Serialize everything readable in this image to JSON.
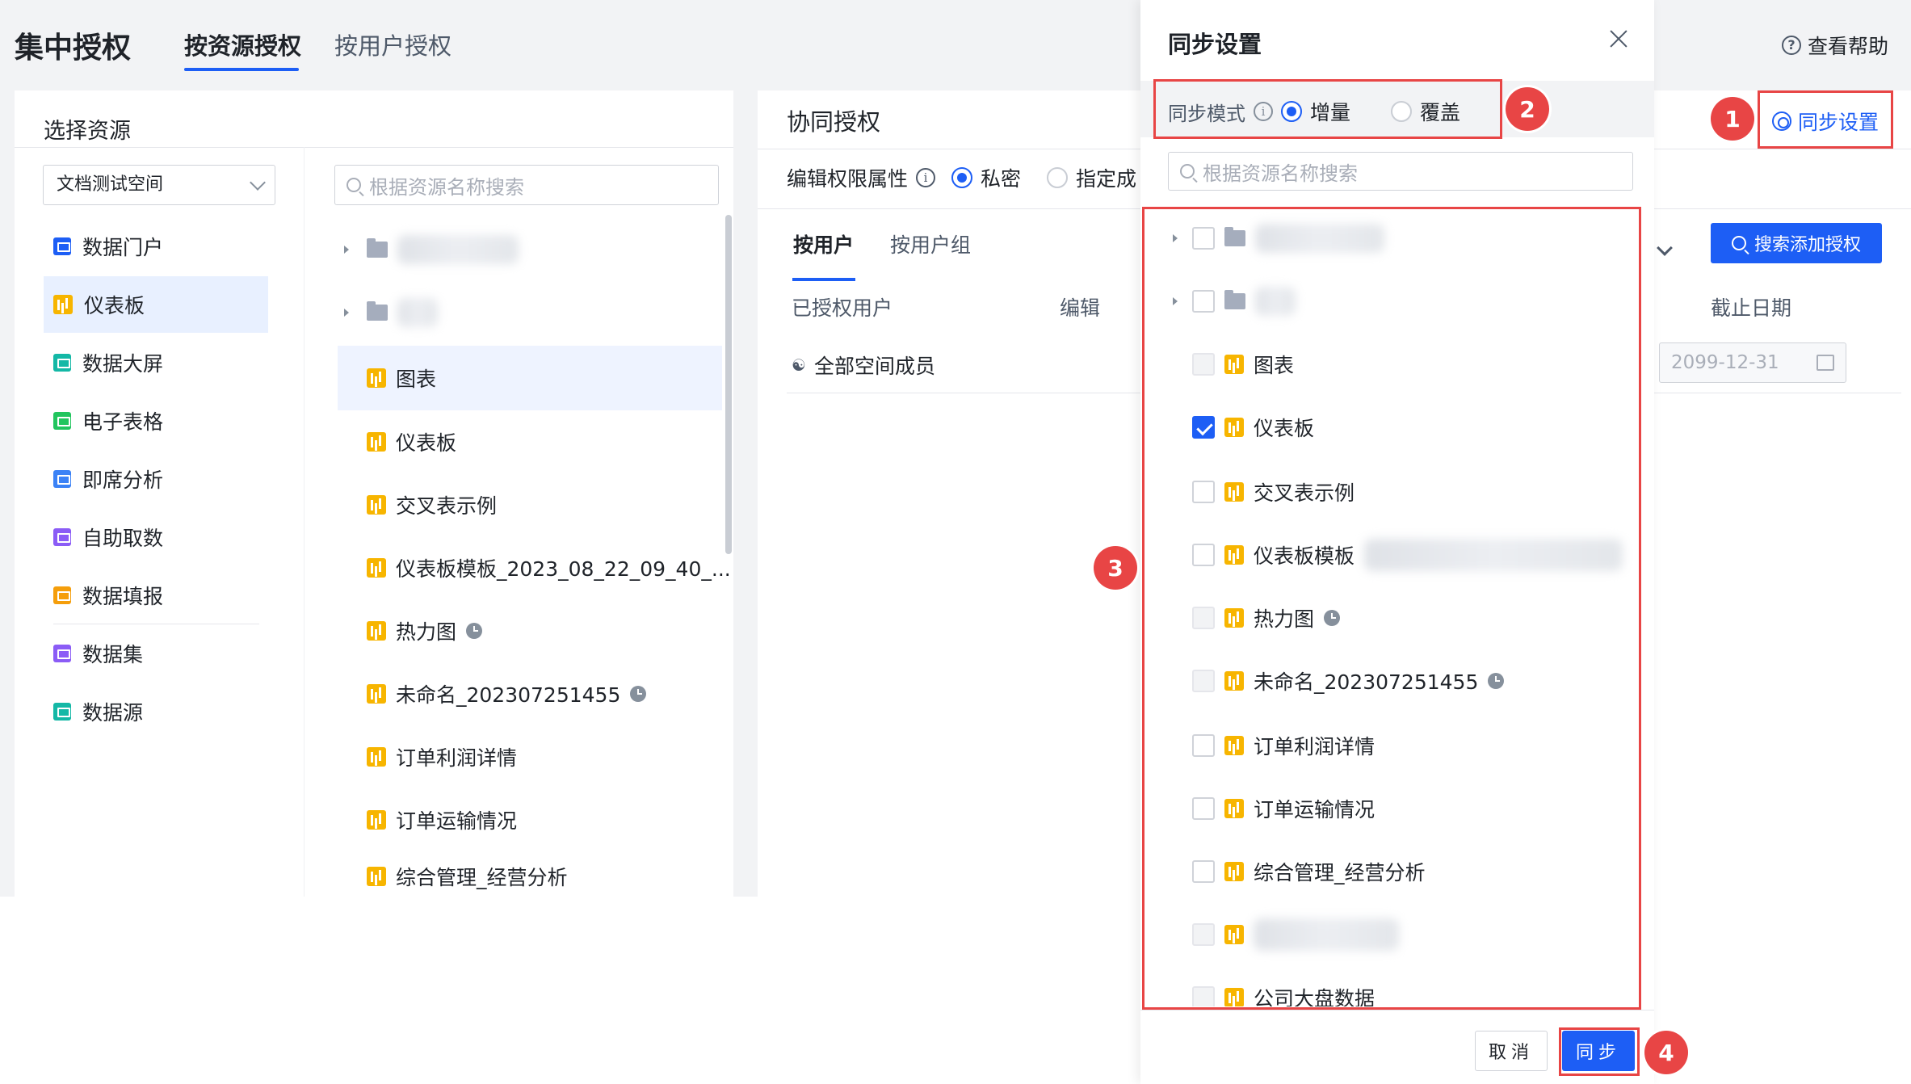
{
  "app": {
    "title": "集中授权",
    "tabs": [
      "按资源授权",
      "按用户授权"
    ],
    "help": "查看帮助"
  },
  "left_panel": {
    "header": "选择资源",
    "space_select": "文档测试空间",
    "categories": [
      {
        "label": "数据门户",
        "color": "#1d5ef5"
      },
      {
        "label": "仪表板",
        "color": "#f7b500"
      },
      {
        "label": "数据大屏",
        "color": "#14b8a6"
      },
      {
        "label": "电子表格",
        "color": "#22c55e"
      },
      {
        "label": "即席分析",
        "color": "#3b82f6"
      },
      {
        "label": "自助取数",
        "color": "#8b5cf6"
      },
      {
        "label": "数据填报",
        "color": "#f59e0b"
      },
      {
        "label": "数据集",
        "color": "#8b5cf6"
      },
      {
        "label": "数据源",
        "color": "#14b8a6"
      }
    ],
    "search_placeholder": "根据资源名称搜索",
    "tree": [
      {
        "label": "图表"
      },
      {
        "label": "仪表板"
      },
      {
        "label": "交叉表示例"
      },
      {
        "label": "仪表板模板_2023_08_22_09_40_..."
      },
      {
        "label": "热力图"
      },
      {
        "label": "未命名_202307251455"
      },
      {
        "label": "订单利润详情"
      },
      {
        "label": "订单运输情况"
      },
      {
        "label": "综合管理_经营分析"
      }
    ]
  },
  "right_panel": {
    "title": "协同授权",
    "permission_label": "编辑权限属性",
    "permission_options": [
      "私密",
      "指定成"
    ],
    "sub_tabs": [
      "按用户",
      "按用户组"
    ],
    "col_authorized_users": "已授权用户",
    "col_edit": "编辑",
    "col_expiry": "截止日期",
    "member_row": "全部空间成员",
    "expiry_date": "2099-12-31",
    "search_add_button": "搜索添加授权",
    "sync_settings_link": "同步设置"
  },
  "drawer": {
    "title": "同步设置",
    "mode_label": "同步模式",
    "mode_options": [
      "增量",
      "覆盖"
    ],
    "search_placeholder": "根据资源名称搜索",
    "items": [
      {
        "label": "图表",
        "checked": false
      },
      {
        "label": "仪表板",
        "checked": true
      },
      {
        "label": "交叉表示例",
        "checked": false
      },
      {
        "label": "仪表板模板",
        "checked": false
      },
      {
        "label": "热力图",
        "checked": false
      },
      {
        "label": "未命名_202307251455",
        "checked": false
      },
      {
        "label": "订单利润详情",
        "checked": false
      },
      {
        "label": "订单运输情况",
        "checked": false
      },
      {
        "label": "综合管理_经营分析",
        "checked": false
      },
      {
        "label": "公司大盘数据",
        "checked": false
      }
    ],
    "cancel_label": "取消",
    "sync_label": "同步"
  },
  "annotations": [
    "1",
    "2",
    "3",
    "4"
  ],
  "colors": {
    "accent": "#1d5ef5",
    "annotation": "#e84545",
    "chart_icon": "#f7b500"
  }
}
